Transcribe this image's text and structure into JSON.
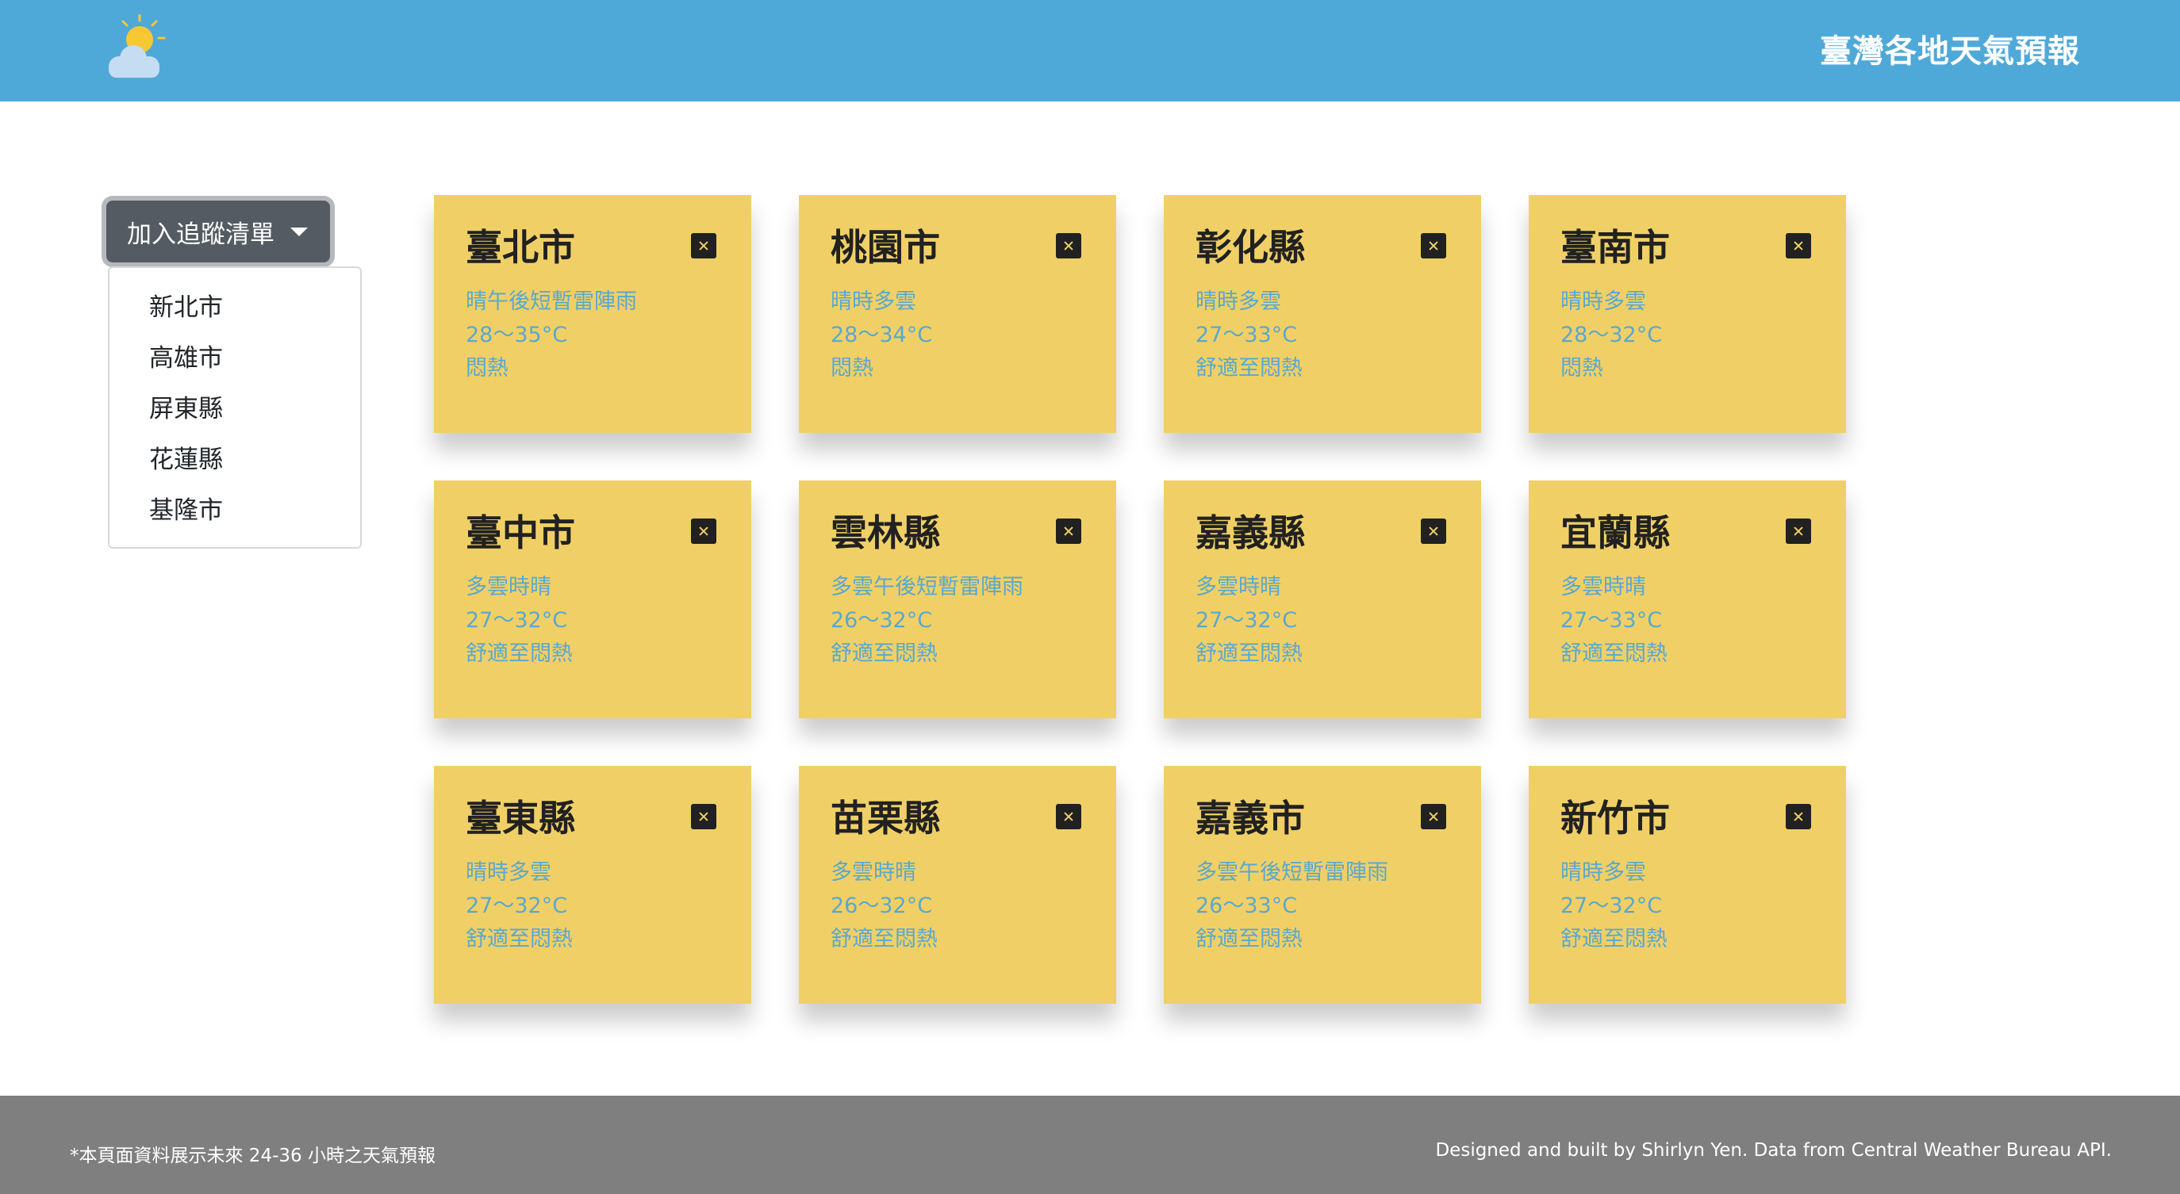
{
  "header": {
    "title": "臺灣各地天氣預報",
    "logo_icon": "sun-behind-cloud-icon"
  },
  "tracker": {
    "button_label": "加入追蹤清單",
    "options": [
      "新北市",
      "高雄市",
      "屏東縣",
      "花蓮縣",
      "基隆市"
    ]
  },
  "cards": [
    {
      "city": "臺北市",
      "weather": "晴午後短暫雷陣雨",
      "temp": "28～35°C",
      "comfort": "悶熱"
    },
    {
      "city": "桃園市",
      "weather": "晴時多雲",
      "temp": "28～34°C",
      "comfort": "悶熱"
    },
    {
      "city": "彰化縣",
      "weather": "晴時多雲",
      "temp": "27～33°C",
      "comfort": "舒適至悶熱"
    },
    {
      "city": "臺南市",
      "weather": "晴時多雲",
      "temp": "28～32°C",
      "comfort": "悶熱"
    },
    {
      "city": "臺中市",
      "weather": "多雲時晴",
      "temp": "27～32°C",
      "comfort": "舒適至悶熱"
    },
    {
      "city": "雲林縣",
      "weather": "多雲午後短暫雷陣雨",
      "temp": "26～32°C",
      "comfort": "舒適至悶熱"
    },
    {
      "city": "嘉義縣",
      "weather": "多雲時晴",
      "temp": "27～32°C",
      "comfort": "舒適至悶熱"
    },
    {
      "city": "宜蘭縣",
      "weather": "多雲時晴",
      "temp": "27～33°C",
      "comfort": "舒適至悶熱"
    },
    {
      "city": "臺東縣",
      "weather": "晴時多雲",
      "temp": "27～32°C",
      "comfort": "舒適至悶熱"
    },
    {
      "city": "苗栗縣",
      "weather": "多雲時晴",
      "temp": "26～32°C",
      "comfort": "舒適至悶熱"
    },
    {
      "city": "嘉義市",
      "weather": "多雲午後短暫雷陣雨",
      "temp": "26～33°C",
      "comfort": "舒適至悶熱"
    },
    {
      "city": "新竹市",
      "weather": "晴時多雲",
      "temp": "27～32°C",
      "comfort": "舒適至悶熱"
    }
  ],
  "footer": {
    "note": "*本頁面資料展示未來 24-36 小時之天氣預報",
    "credit": "Designed and built by Shirlyn Yen. Data from Central Weather Bureau API."
  },
  "colors": {
    "header_bg": "#4fa9d8",
    "card_bg": "#f0d066",
    "card_text_accent": "#5aa8cf",
    "footer_bg": "#7f7f7f",
    "button_bg": "#545b62"
  }
}
